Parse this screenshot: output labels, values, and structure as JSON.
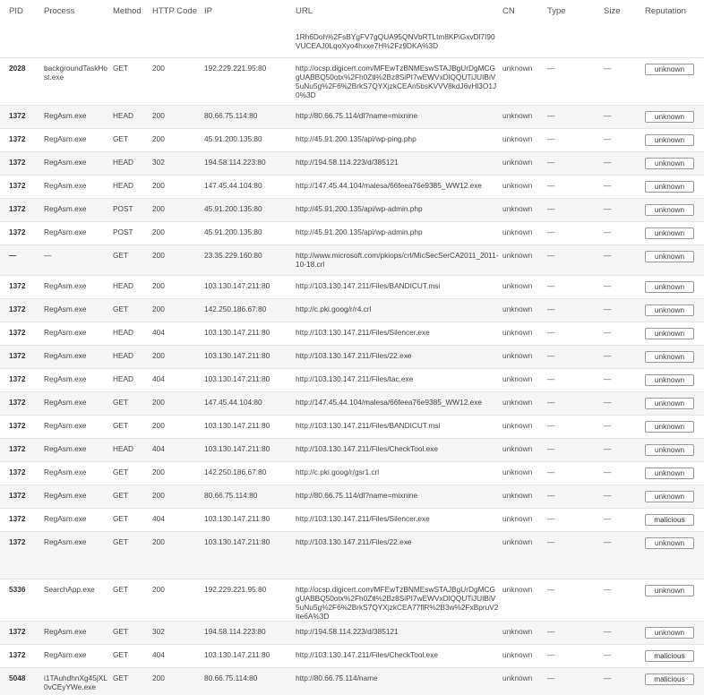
{
  "headers": {
    "pid": "PID",
    "process": "Process",
    "method": "Method",
    "http_code": "HTTP Code",
    "ip": "IP",
    "url": "URL",
    "cn": "CN",
    "type": "Type",
    "size": "Size",
    "reputation": "Reputation"
  },
  "partial_url": "1Rh6Doh%2FsBYgFV7gQUA95QNVbRTLtm8KPiGxvDl7I90VUCEAJ0LqoXyo4hxxe7H%2Fz9DKA%3D",
  "rows": [
    {
      "pid": "2028",
      "process": "backgroundTaskHost.exe",
      "method": "GET",
      "code": "200",
      "ip": "192.229.221.95:80",
      "url": "http://ocsp.digicert.com/MFEwTzBNMEswSTAJBgUrDgMCGgUABBQ50otx%2Fh0Ztl%2Bz8SiPI7wEWVxDlQQUTiJUIBiV5uNu5g%2F6%2BrkS7QYXjzkCEAn5bsKVVV8kdJ6vHl3O1J0%3D",
      "cn": "unknown",
      "type": "—",
      "size": "—",
      "rep": "unknown"
    },
    {
      "pid": "1372",
      "process": "RegAsm.exe",
      "method": "HEAD",
      "code": "200",
      "ip": "80.66.75.114:80",
      "url": "http://80.66.75.114/dl?name=mixnine",
      "cn": "unknown",
      "type": "—",
      "size": "—",
      "rep": "unknown"
    },
    {
      "pid": "1372",
      "process": "RegAsm.exe",
      "method": "GET",
      "code": "200",
      "ip": "45.91.200.135:80",
      "url": "http://45.91.200.135/api/wp-ping.php",
      "cn": "unknown",
      "type": "—",
      "size": "—",
      "rep": "unknown"
    },
    {
      "pid": "1372",
      "process": "RegAsm.exe",
      "method": "HEAD",
      "code": "302",
      "ip": "194.58.114.223:80",
      "url": "http://194.58.114.223/d/385121",
      "cn": "unknown",
      "type": "—",
      "size": "—",
      "rep": "unknown"
    },
    {
      "pid": "1372",
      "process": "RegAsm.exe",
      "method": "HEAD",
      "code": "200",
      "ip": "147.45.44.104:80",
      "url": "http://147.45.44.104/malesa/66feea76e9385_WW12.exe",
      "cn": "unknown",
      "type": "—",
      "size": "—",
      "rep": "unknown"
    },
    {
      "pid": "1372",
      "process": "RegAsm.exe",
      "method": "POST",
      "code": "200",
      "ip": "45.91.200.135:80",
      "url": "http://45.91.200.135/api/wp-admin.php",
      "cn": "unknown",
      "type": "—",
      "size": "—",
      "rep": "unknown"
    },
    {
      "pid": "1372",
      "process": "RegAsm.exe",
      "method": "POST",
      "code": "200",
      "ip": "45.91.200.135:80",
      "url": "http://45.91.200.135/api/wp-admin.php",
      "cn": "unknown",
      "type": "—",
      "size": "—",
      "rep": "unknown"
    },
    {
      "pid": "—",
      "process": "—",
      "method": "GET",
      "code": "200",
      "ip": "23.35.229.160:80",
      "url": "http://www.microsoft.com/pkiops/crl/MicSecSerCA2011_2011-10-18.crl",
      "cn": "unknown",
      "type": "—",
      "size": "—",
      "rep": "unknown"
    },
    {
      "pid": "1372",
      "process": "RegAsm.exe",
      "method": "HEAD",
      "code": "200",
      "ip": "103.130.147.211:80",
      "url": "http://103.130.147.211/Files/BANDICUT.msi",
      "cn": "unknown",
      "type": "—",
      "size": "—",
      "rep": "unknown"
    },
    {
      "pid": "1372",
      "process": "RegAsm.exe",
      "method": "GET",
      "code": "200",
      "ip": "142.250.186.67:80",
      "url": "http://c.pki.goog/r/r4.crl",
      "cn": "unknown",
      "type": "—",
      "size": "—",
      "rep": "unknown"
    },
    {
      "pid": "1372",
      "process": "RegAsm.exe",
      "method": "HEAD",
      "code": "404",
      "ip": "103.130.147.211:80",
      "url": "http://103.130.147.211/Files/Silencer.exe",
      "cn": "unknown",
      "type": "—",
      "size": "—",
      "rep": "unknown"
    },
    {
      "pid": "1372",
      "process": "RegAsm.exe",
      "method": "HEAD",
      "code": "200",
      "ip": "103.130.147.211:80",
      "url": "http://103.130.147.211/Files/22.exe",
      "cn": "unknown",
      "type": "—",
      "size": "—",
      "rep": "unknown"
    },
    {
      "pid": "1372",
      "process": "RegAsm.exe",
      "method": "HEAD",
      "code": "404",
      "ip": "103.130.147.211:80",
      "url": "http://103.130.147.211/Files/tac.exe",
      "cn": "unknown",
      "type": "—",
      "size": "—",
      "rep": "unknown"
    },
    {
      "pid": "1372",
      "process": "RegAsm.exe",
      "method": "GET",
      "code": "200",
      "ip": "147.45.44.104:80",
      "url": "http://147.45.44.104/malesa/66feea76e9385_WW12.exe",
      "cn": "unknown",
      "type": "—",
      "size": "—",
      "rep": "unknown"
    },
    {
      "pid": "1372",
      "process": "RegAsm.exe",
      "method": "GET",
      "code": "200",
      "ip": "103.130.147.211:80",
      "url": "http://103.130.147.211/Files/BANDICUT.msi",
      "cn": "unknown",
      "type": "—",
      "size": "—",
      "rep": "unknown"
    },
    {
      "pid": "1372",
      "process": "RegAsm.exe",
      "method": "HEAD",
      "code": "404",
      "ip": "103.130.147.211:80",
      "url": "http://103.130.147.211/Files/CheckTool.exe",
      "cn": "unknown",
      "type": "—",
      "size": "—",
      "rep": "unknown"
    },
    {
      "pid": "1372",
      "process": "RegAsm.exe",
      "method": "GET",
      "code": "200",
      "ip": "142.250.186.67:80",
      "url": "http://c.pki.goog/r/gsr1.crl",
      "cn": "unknown",
      "type": "—",
      "size": "—",
      "rep": "unknown"
    },
    {
      "pid": "1372",
      "process": "RegAsm.exe",
      "method": "GET",
      "code": "200",
      "ip": "80.66.75.114:80",
      "url": "http://80.66.75.114/dl?name=mixnine",
      "cn": "unknown",
      "type": "—",
      "size": "—",
      "rep": "unknown"
    },
    {
      "pid": "1372",
      "process": "RegAsm.exe",
      "method": "GET",
      "code": "404",
      "ip": "103.130.147.211:80",
      "url": "http://103.130.147.211/Files/Silencer.exe",
      "cn": "unknown",
      "type": "—",
      "size": "—",
      "rep": "malicious"
    },
    {
      "pid": "1372",
      "process": "RegAsm.exe",
      "method": "GET",
      "code": "200",
      "ip": "103.130.147.211:80",
      "url": "http://103.130.147.211/Files/22.exe",
      "cn": "unknown",
      "type": "—",
      "size": "—",
      "rep": "unknown"
    },
    {
      "pid": "5336",
      "process": "SearchApp.exe",
      "method": "GET",
      "code": "200",
      "ip": "192.229.221.95:80",
      "url": "http://ocsp.digicert.com/MFEwTzBNMEswSTAJBgUrDgMCGgUABBQ50otx%2Fh0Ztl%2Bz8SiPI7wEWVxDlQQUTiJUIBiV5uNu5g%2F6%2BrkS7QYXjzkCEA77flR%2B3w%2FxBpruV2Ite6A%3D",
      "cn": "unknown",
      "type": "—",
      "size": "—",
      "rep": "unknown"
    },
    {
      "pid": "1372",
      "process": "RegAsm.exe",
      "method": "GET",
      "code": "302",
      "ip": "194.58.114.223:80",
      "url": "http://194.58.114.223/d/385121",
      "cn": "unknown",
      "type": "—",
      "size": "—",
      "rep": "unknown"
    },
    {
      "pid": "1372",
      "process": "RegAsm.exe",
      "method": "GET",
      "code": "404",
      "ip": "103.130.147.211:80",
      "url": "http://103.130.147.211/Files/CheckTool.exe",
      "cn": "unknown",
      "type": "—",
      "size": "—",
      "rep": "malicious"
    },
    {
      "pid": "5048",
      "process": "i1TAuhdhnXg45jXL0vCEyYWe.exe",
      "method": "GET",
      "code": "200",
      "ip": "80.66.75.114:80",
      "url": "http://80.66.75.114/name",
      "cn": "unknown",
      "type": "—",
      "size": "—",
      "rep": "malicious"
    }
  ]
}
